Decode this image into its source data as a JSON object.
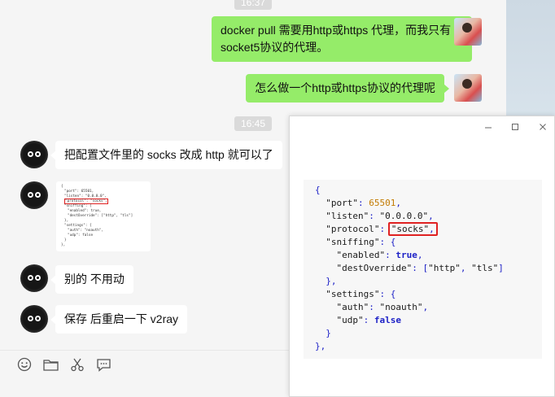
{
  "timestamps": {
    "top": "16:37",
    "mid": "16:45"
  },
  "messages": {
    "m1": "docker pull 需要用http或https 代理，而我只有socket5协议的代理。",
    "m2": "怎么做一个http或https协议的代理呢",
    "m3": "把配置文件里的 socks  改成 http 就可以了",
    "m5": "别的 不用动",
    "m6": "保存 后重启一下  v2ray"
  },
  "thumbnail": {
    "lines": [
      "{",
      "\"port\": 65501,",
      "\"listen\": \"0.0.0.0\",",
      "\"protocol\": \"socks\",",
      "\"sniffing\": {",
      "\"enabled\": true,",
      "\"destOverride\": [\"http\", \"tls\"]",
      "},",
      "\"settings\": {",
      "\"auth\": \"noauth\",",
      "\"udp\": false",
      "}",
      "},"
    ]
  },
  "image_viewer": {
    "controls": {
      "minimize": "—",
      "maximize": "☐",
      "close": "✕"
    },
    "code": {
      "open": "{",
      "port_key": "\"port\"",
      "port_val": "65501",
      "listen_key": "\"listen\"",
      "listen_val": "\"0.0.0.0\"",
      "protocol_key": "\"protocol\"",
      "protocol_val": "\"socks\"",
      "sniffing_key": "\"sniffing\"",
      "enabled_key": "\"enabled\"",
      "enabled_val": "true",
      "dest_key": "\"destOverride\"",
      "dest_v1": "\"http\"",
      "dest_v2": "\"tls\"",
      "settings_key": "\"settings\"",
      "auth_key": "\"auth\"",
      "auth_val": "\"noauth\"",
      "udp_key": "\"udp\"",
      "udp_val": "false"
    },
    "highlight_color": "#e02222"
  },
  "toolbar": {
    "icons": [
      "emoji-icon",
      "folder-icon",
      "scissors-icon",
      "chat-bubble-icon"
    ]
  },
  "colors": {
    "my_bubble": "#95ec69",
    "their_bubble": "#ffffff",
    "background": "#f5f5f5"
  }
}
